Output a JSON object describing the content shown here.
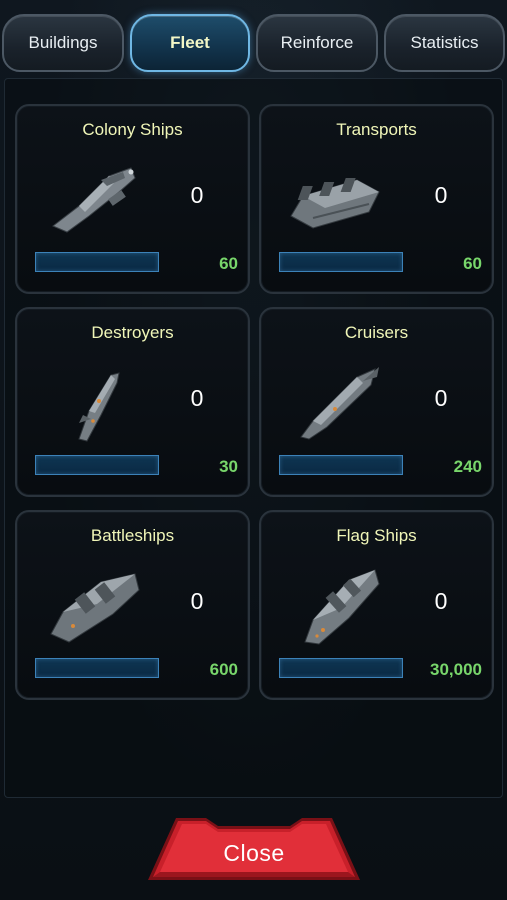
{
  "tabs": [
    {
      "label": "Buildings",
      "active": false
    },
    {
      "label": "Fleet",
      "active": true
    },
    {
      "label": "Reinforce",
      "active": false
    },
    {
      "label": "Statistics",
      "active": false
    }
  ],
  "ships": [
    {
      "name": "Colony Ships",
      "count": "0",
      "cost": "60",
      "icon": "colony-ship-icon"
    },
    {
      "name": "Transports",
      "count": "0",
      "cost": "60",
      "icon": "transport-ship-icon"
    },
    {
      "name": "Destroyers",
      "count": "0",
      "cost": "30",
      "icon": "destroyer-ship-icon"
    },
    {
      "name": "Cruisers",
      "count": "0",
      "cost": "240",
      "icon": "cruiser-ship-icon"
    },
    {
      "name": "Battleships",
      "count": "0",
      "cost": "600",
      "icon": "battleship-icon"
    },
    {
      "name": "Flag Ships",
      "count": "0",
      "cost": "30,000",
      "icon": "flagship-icon"
    }
  ],
  "close_label": "Close",
  "colors": {
    "title": "#f0f6b8",
    "cost": "#78d66b",
    "active_tab_border": "#6fb7e4",
    "close_button": "#c8202a"
  }
}
